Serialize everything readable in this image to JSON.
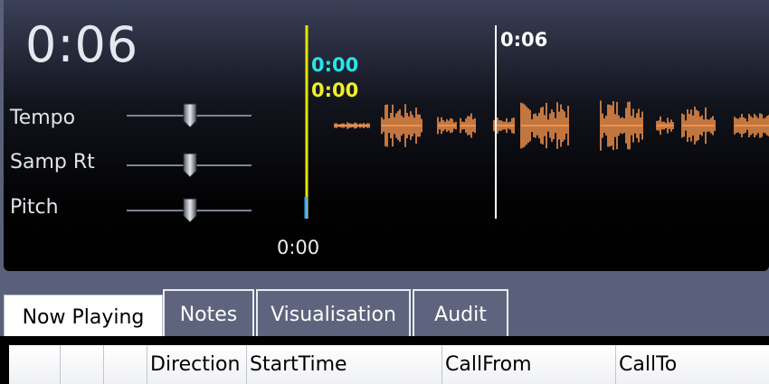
{
  "player": {
    "clock": "0:06",
    "start_time": "0:00",
    "sliders": [
      {
        "label": "Tempo",
        "value": 0.5
      },
      {
        "label": "Samp Rt",
        "value": 0.5
      },
      {
        "label": "Pitch",
        "value": 0.5
      }
    ],
    "markers": {
      "start_cyan": "0:00",
      "start_yellow": "0:00",
      "playhead": "0:06"
    },
    "colors": {
      "waveform": "#f0914a",
      "start_marker": "#e6e600",
      "cyan_label": "#28e4ea",
      "yellow_label": "#f0ef28",
      "playhead": "#ffffff"
    }
  },
  "tabs": [
    {
      "label": "Now Playing",
      "active": true
    },
    {
      "label": "Notes",
      "active": false
    },
    {
      "label": "Visualisation",
      "active": false
    },
    {
      "label": "Audit",
      "active": false
    }
  ],
  "grid": {
    "columns": [
      "",
      "",
      "",
      "Direction",
      "StartTime",
      "CallFrom",
      "CallTo"
    ]
  }
}
